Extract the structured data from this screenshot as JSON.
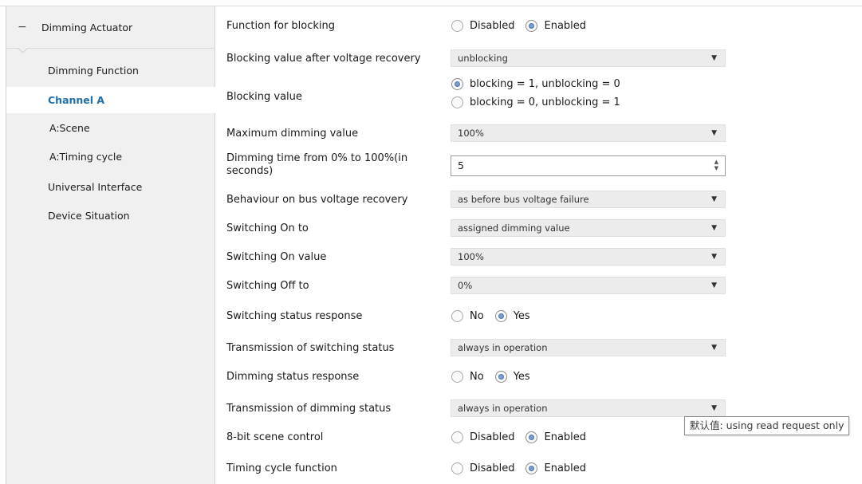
{
  "sidebar": {
    "header_symbol": "−",
    "header_label": "Dimming Actuator",
    "items": [
      {
        "label": "Dimming Function"
      },
      {
        "label": "Channel A"
      },
      {
        "label": "A:Scene"
      },
      {
        "label": "A:Timing cycle"
      },
      {
        "label": "Universal Interface"
      },
      {
        "label": "Device Situation"
      }
    ],
    "active_item": "Channel A"
  },
  "params": {
    "function_for_blocking": {
      "label": "Function for blocking",
      "options": [
        "Disabled",
        "Enabled"
      ],
      "selected": "Enabled"
    },
    "blocking_value_after_recovery": {
      "label": "Blocking value after voltage recovery",
      "value": "unblocking"
    },
    "blocking_value": {
      "label": "Blocking value",
      "options": [
        "blocking = 1, unblocking = 0",
        "blocking = 0, unblocking = 1"
      ],
      "selected": "blocking = 1, unblocking = 0"
    },
    "maximum_dimming_value": {
      "label": "Maximum dimming value",
      "value": "100%"
    },
    "dimming_time": {
      "label_line1": "Dimming time from 0% to 100%(in",
      "label_line2": "seconds)",
      "value": "5"
    },
    "behaviour_on_recovery": {
      "label": "Behaviour on bus voltage recovery",
      "value": "as before bus voltage failure"
    },
    "switching_on_to": {
      "label": "Switching On to",
      "value": "assigned dimming value"
    },
    "switching_on_value": {
      "label": "Switching On value",
      "value": "100%"
    },
    "switching_off_to": {
      "label": "Switching Off to",
      "value": "0%"
    },
    "switching_status_response": {
      "label": "Switching status response",
      "options": [
        "No",
        "Yes"
      ],
      "selected": "Yes"
    },
    "transmission_switching_status": {
      "label": "Transmission of switching status",
      "value": "always in operation"
    },
    "dimming_status_response": {
      "label": "Dimming status response",
      "options": [
        "No",
        "Yes"
      ],
      "selected": "Yes"
    },
    "transmission_dimming_status": {
      "label": "Transmission of dimming status",
      "value": "always in operation"
    },
    "scene_control_8bit": {
      "label": "8-bit scene control",
      "options": [
        "Disabled",
        "Enabled"
      ],
      "selected": "Enabled"
    },
    "timing_cycle_function": {
      "label": "Timing cycle function",
      "options": [
        "Disabled",
        "Enabled"
      ],
      "selected": "Enabled"
    }
  },
  "tooltip": {
    "text": "默认值: using read request only"
  },
  "icons": {
    "dropdown": "chevron-down-icon",
    "spinner": "spinner-arrows-icon"
  },
  "colors": {
    "active_item_text": "#1f6fa7",
    "sidebar_bg": "#f0f0f0",
    "select_bg": "#ececec",
    "radio_fill": "#7b9fcc"
  }
}
